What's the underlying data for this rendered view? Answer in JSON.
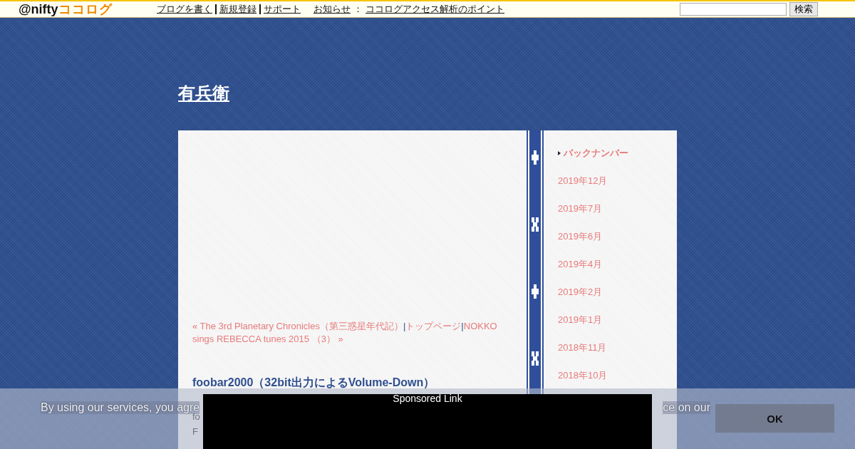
{
  "topbar": {
    "logo": {
      "at": "@nifty",
      "name": "ココログ"
    },
    "links": [
      {
        "label": "ブログを書く"
      },
      {
        "label": "新規登録"
      },
      {
        "label": "サポート"
      }
    ],
    "notice": {
      "label": "お知らせ",
      "sep": "：",
      "link": "ココログアクセス解析のポイント"
    },
    "search": {
      "button": "検索"
    }
  },
  "blog_title": "有兵衛",
  "post_nav": {
    "prev": "« The 3rd Planetary Chronicles（第三惑星年代記）",
    "sep1": "|",
    "top": "トップページ",
    "sep2": "|",
    "next": "NOKKO sings REBECCA tunes 2015 （3） »"
  },
  "post": {
    "title": "foobar2000（32bit出力によるVolume-Down）",
    "lines": [
      "fo",
      "F"
    ]
  },
  "sidebar": {
    "heading": "バックナンバー",
    "items": [
      "2019年12月",
      "2019年7月",
      "2019年6月",
      "2019年4月",
      "2019年2月",
      "2019年1月",
      "2018年11月",
      "2018年10月"
    ]
  },
  "cookie_banner": {
    "text_left": "By using our services, you agre",
    "text_right": "ce on our",
    "button": "OK"
  },
  "ad": {
    "label": "Sponsored Link"
  }
}
